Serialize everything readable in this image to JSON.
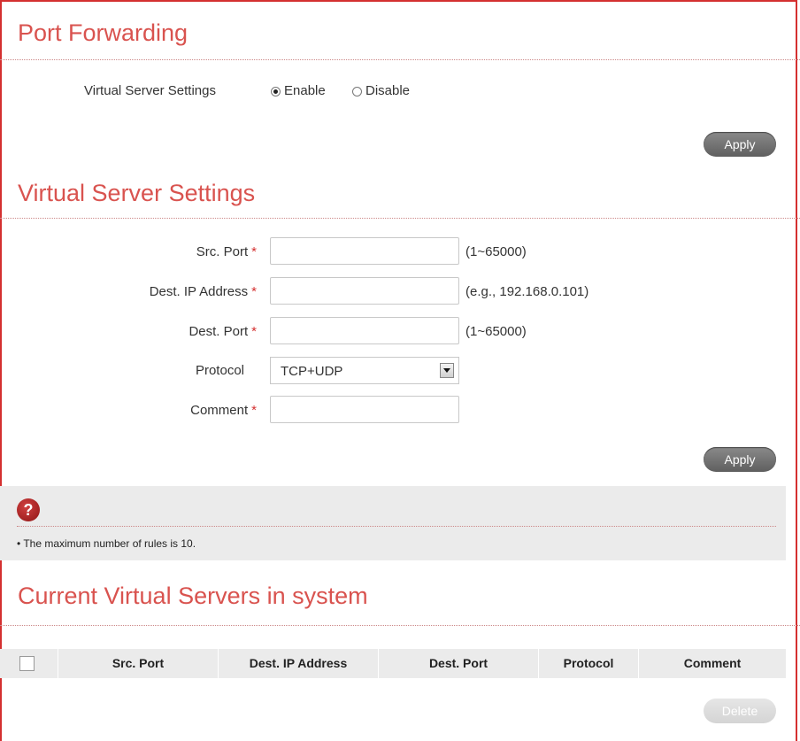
{
  "port_forwarding": {
    "title": "Port Forwarding",
    "virtual_server_label": "Virtual Server Settings",
    "enable_label": "Enable",
    "disable_label": "Disable",
    "selected": "Enable",
    "apply_label": "Apply"
  },
  "virtual_server_settings": {
    "title": "Virtual Server Settings",
    "fields": {
      "src_port": {
        "label": "Src. Port",
        "required": "*",
        "value": "",
        "hint": "(1~65000)"
      },
      "dest_ip": {
        "label": "Dest. IP Address",
        "required": "*",
        "value": "",
        "hint": "(e.g., 192.168.0.101)"
      },
      "dest_port": {
        "label": "Dest. Port",
        "required": "*",
        "value": "",
        "hint": "(1~65000)"
      },
      "protocol": {
        "label": "Protocol",
        "value": "TCP+UDP"
      },
      "comment": {
        "label": "Comment",
        "required": "*",
        "value": ""
      }
    },
    "apply_label": "Apply"
  },
  "help": {
    "icon_char": "?",
    "text": "• The maximum number of rules is 10."
  },
  "current_servers": {
    "title": "Current Virtual Servers in system",
    "columns": [
      "Src. Port",
      "Dest. IP Address",
      "Dest. Port",
      "Protocol",
      "Comment"
    ],
    "rows": [],
    "delete_label": "Delete"
  },
  "colors": {
    "accent": "#d9534f",
    "frame": "#d43030",
    "button": "#6f6f6f"
  }
}
